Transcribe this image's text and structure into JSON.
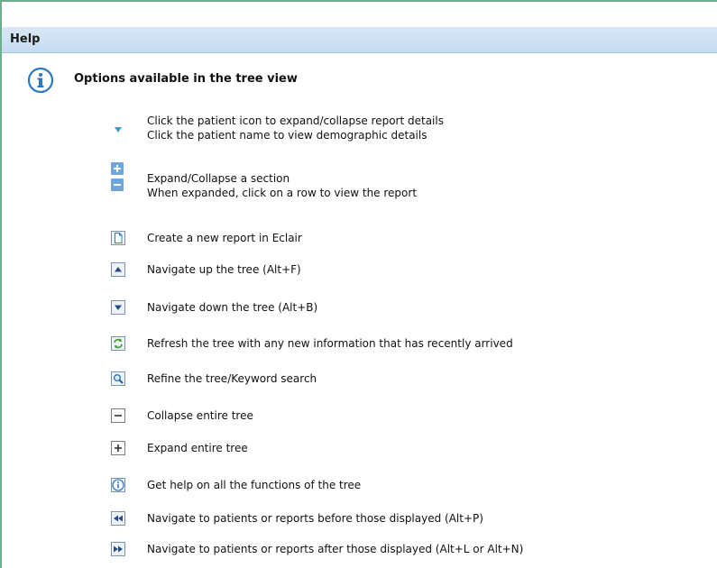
{
  "header": {
    "title": "Help"
  },
  "section": {
    "title": "Options available in the tree view"
  },
  "items": {
    "patient_icon": {
      "line1": "Click the patient icon to expand/collapse report details",
      "line2": "Click the patient name to view demographic details"
    },
    "expand_section": {
      "line1": "Expand/Collapse a section",
      "line2": "When expanded, click on a row to view the report"
    },
    "new_report": "Create a new report in Eclair",
    "nav_up": "Navigate up the tree (Alt+F)",
    "nav_down": "Navigate down the tree (Alt+B)",
    "refresh": "Refresh the tree with any new information that has recently arrived",
    "refine": "Refine the tree/Keyword search",
    "collapse_all": "Collapse entire tree",
    "expand_all": "Expand entire tree",
    "help": "Get help on all the functions of the tree",
    "nav_prev": "Navigate to patients or reports before those displayed (Alt+P)",
    "nav_next": "Navigate to patients or reports after those displayed (Alt+L or Alt+N)"
  },
  "icons": [
    "info-icon",
    "triangle-down-icon",
    "plus-square-icon",
    "minus-square-icon",
    "new-document-icon",
    "arrow-up-icon",
    "arrow-down-icon",
    "refresh-icon",
    "magnifier-icon",
    "collapse-all-icon",
    "expand-all-icon",
    "help-icon",
    "rewind-icon",
    "fast-forward-icon"
  ],
  "colors": {
    "accent_blue": "#2f78c4",
    "header_bg": "#c6dbf1",
    "frame_green": "#6fae8c",
    "refresh_green": "#3a9a2a"
  }
}
